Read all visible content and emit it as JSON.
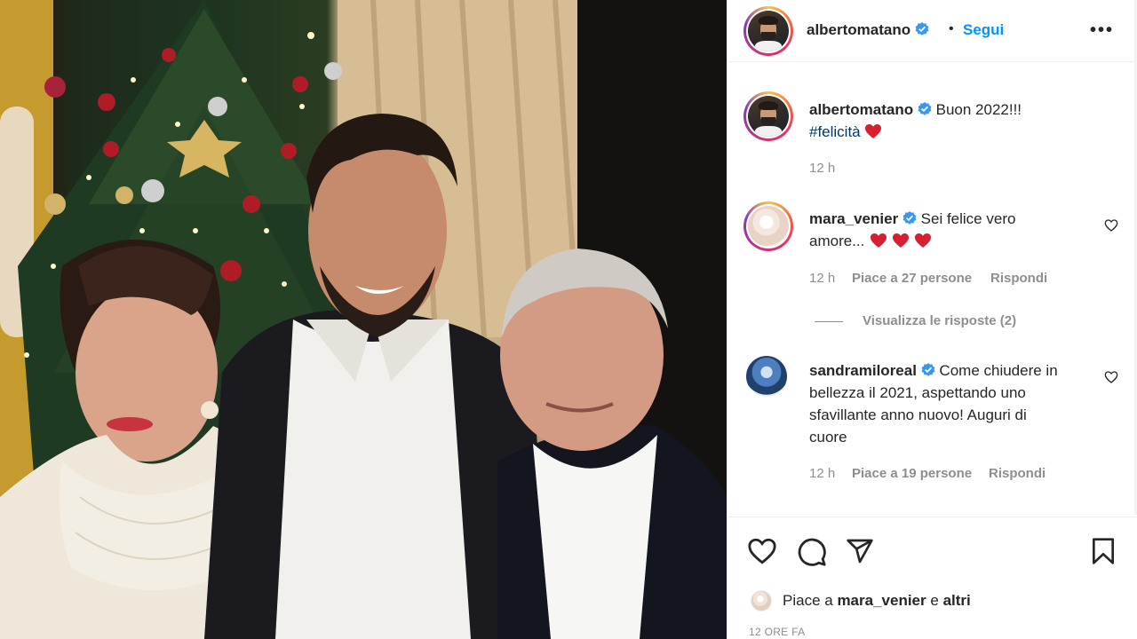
{
  "post": {
    "author": "albertomatano",
    "follow_label": "Segui",
    "dot": "•",
    "more_label": "•••",
    "caption": {
      "username": "albertomatano",
      "text": "Buon 2022!!!",
      "hashtag": "#felicità",
      "time": "12 h"
    }
  },
  "comments": [
    {
      "username": "mara_venier",
      "text_line1": "Sei felice vero",
      "text_line2": "amore...",
      "time": "12 h",
      "likes": "Piace a 27 persone",
      "reply": "Rispondi",
      "view_replies": "Visualizza le risposte (2)"
    },
    {
      "username": "sandramiloreal",
      "text_line1": "Come chiudere in",
      "text_line2": "bellezza il 2021, aspettando uno",
      "text_line3": "sfavillante anno nuovo! Auguri di",
      "text_line4": "cuore",
      "time": "12 h",
      "likes": "Piace a 19 persone",
      "reply": "Rispondi"
    }
  ],
  "footer": {
    "likes_prefix": "Piace a",
    "likes_user": "mara_venier",
    "likes_and": "e",
    "likes_others": "altri",
    "time_ago": "12 ORE FA"
  },
  "icons": {
    "like": "heart-outline-icon",
    "comment": "comment-bubble-icon",
    "share": "paper-plane-icon",
    "save": "bookmark-icon",
    "verified": "verified-badge-icon",
    "more": "more-horizontal-icon"
  },
  "colors": {
    "accent": "#0095f6",
    "verified": "#3897f0",
    "heart_red": "#ed4956",
    "muted": "#8e8e8e"
  }
}
